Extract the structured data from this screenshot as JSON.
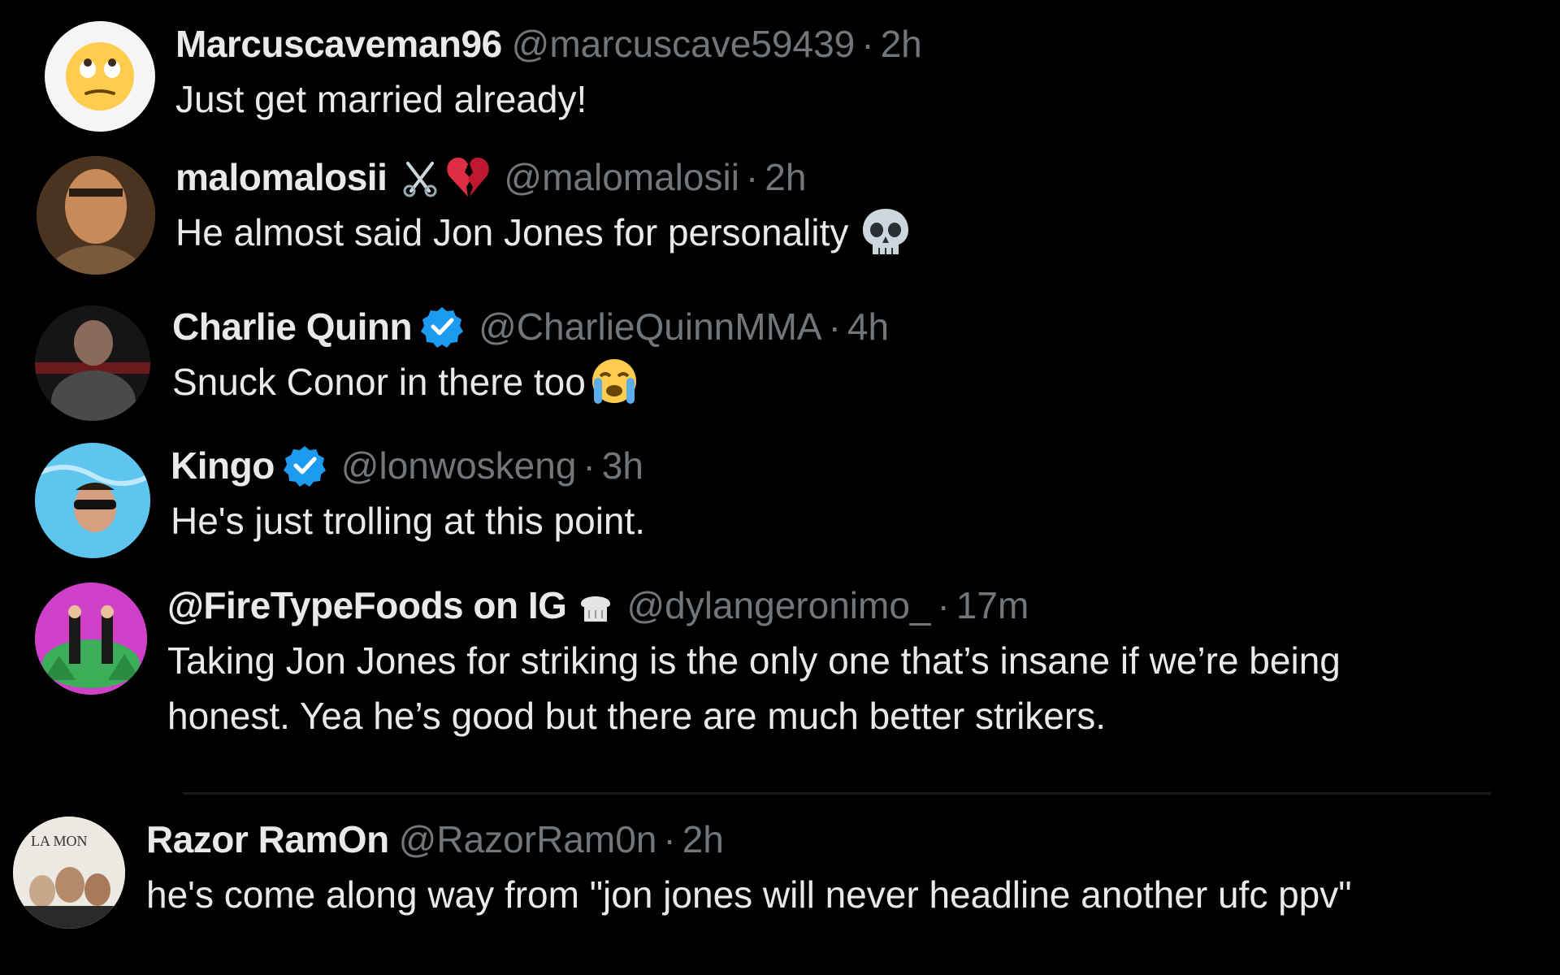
{
  "replies": [
    {
      "name": "Marcuscaveman96",
      "handle": "@marcuscave59439",
      "separator": "·",
      "time": "2h",
      "text": "Just get married already!",
      "avatar": "eye-roll-emoji-avatar"
    },
    {
      "name": "malomalosii",
      "name_emojis": [
        "scissors-icon",
        "broken-heart-icon"
      ],
      "handle": "@malomalosii",
      "separator": "·",
      "time": "2h",
      "text": "He almost said Jon Jones for personality",
      "text_emoji": "skull-icon",
      "avatar": "photo-avatar"
    },
    {
      "name": "Charlie Quinn",
      "verified": true,
      "handle": "@CharlieQuinnMMA",
      "separator": "·",
      "time": "4h",
      "text": "Snuck Conor in there too",
      "text_emoji": "crying-face-icon",
      "avatar": "photo-avatar"
    },
    {
      "name": "Kingo",
      "verified": true,
      "handle": "@lonwoskeng",
      "separator": "·",
      "time": "3h",
      "text": "He's just trolling at this point.",
      "avatar": "photo-avatar"
    },
    {
      "name": "@FireTypeFoods on IG",
      "name_emojis": [
        "bread-icon"
      ],
      "handle": "@dylangeronimo_",
      "separator": "·",
      "time": "17m",
      "text": "Taking Jon Jones for striking is the only one that’s insane if we’re being\nhonest. Yea he’s good but there are much better strikers.",
      "avatar": "illustration-avatar"
    },
    {
      "name": "Razor RamOn",
      "handle": "@RazorRam0n",
      "separator": "·",
      "time": "2h",
      "text": "he's come along way from \"jon jones will never headline another ufc ppv\"",
      "avatar": "photo-avatar",
      "avatar_text": "LA MON"
    }
  ],
  "colors": {
    "background": "#000000",
    "primary_text": "#e7e9ea",
    "secondary_text": "#71767b",
    "verified_blue": "#1d9bf0"
  }
}
